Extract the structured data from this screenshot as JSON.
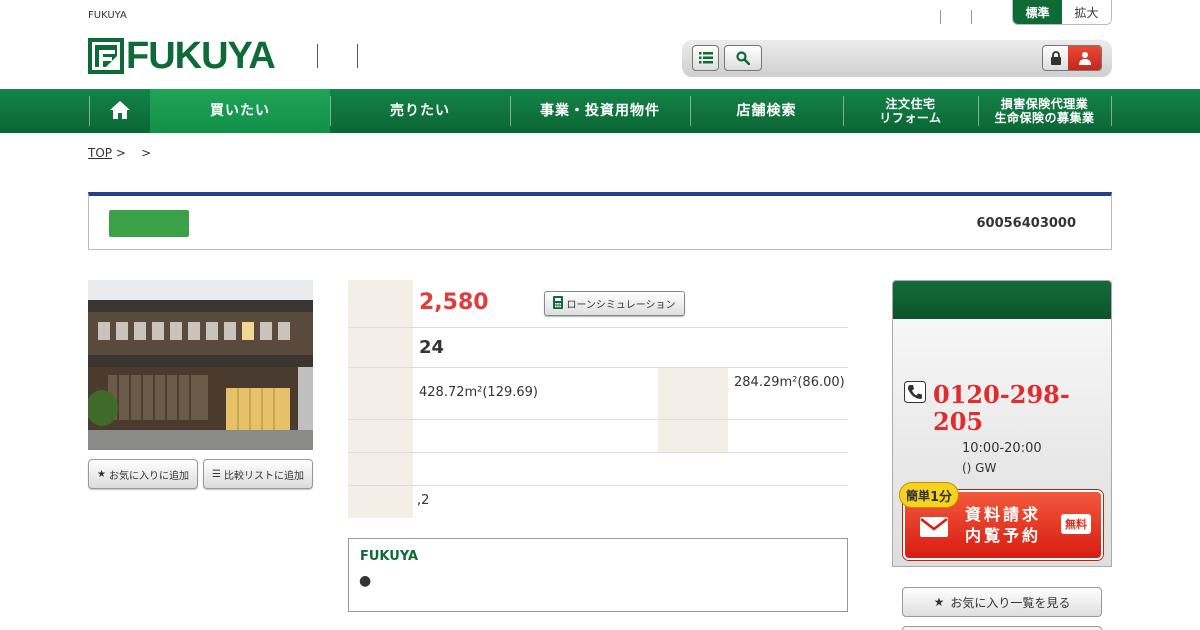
{
  "header": {
    "tagline": "FUKUYA",
    "logo_text": "FUKUYA",
    "size_standard": "標準",
    "size_large": "拡大",
    "colors": {
      "brand_green": "#0e6b36",
      "accent_red": "#e03c3c",
      "title_blue": "#23408a"
    }
  },
  "nav": {
    "home_icon": "home-icon",
    "buy": "買いたい",
    "sell": "売りたい",
    "business": "事業・投資用物件",
    "stores": "店舗検索",
    "custom_home_line1": "注文住宅",
    "custom_home_line2": "リフォーム",
    "insurance_line1": "損害保険代理業",
    "insurance_line2": "生命保険の募集業"
  },
  "breadcrumb": {
    "top": "TOP",
    "sep1": ">",
    "sep2": ">"
  },
  "property": {
    "id": "60056403000",
    "price": "2,580",
    "loan_label": "ローンシミュレーション",
    "age": "24",
    "land_area": "428.72m²(129.69)",
    "building_area": "284.29m²(86.00)",
    "misc": ",2",
    "fav_add": "お気に入りに追加",
    "compare_add": "比較リストに追加"
  },
  "note": {
    "title": "FUKUYA",
    "bullet": "●"
  },
  "contact": {
    "tel": "0120-298-205",
    "hours": "10:00-20:00",
    "holiday": "() GW",
    "badge_pre": "簡単",
    "badge_num": "1分",
    "request_line1": "資料請求",
    "request_line2": "内覧予約",
    "free_label": "無料",
    "fav_list": "お気に入り一覧を見る"
  }
}
